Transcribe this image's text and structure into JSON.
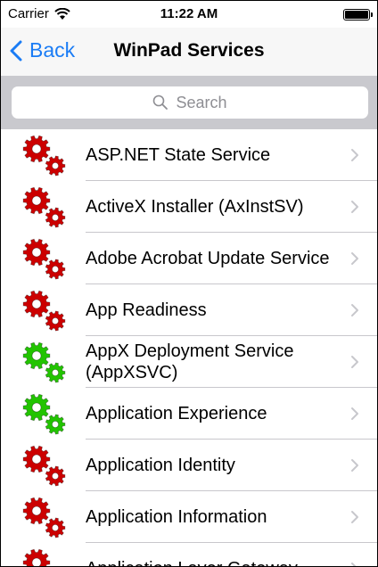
{
  "status_bar": {
    "carrier": "Carrier",
    "time": "11:22 AM"
  },
  "nav": {
    "back_label": "Back",
    "title": "WinPad Services"
  },
  "search": {
    "placeholder": "Search"
  },
  "colors": {
    "stopped": "#cc0000",
    "running": "#22c400",
    "accent": "#1a7cf5"
  },
  "services": [
    {
      "name": "ASP.NET State Service",
      "status": "stopped"
    },
    {
      "name": "ActiveX Installer (AxInstSV)",
      "status": "stopped"
    },
    {
      "name": "Adobe Acrobat Update Service",
      "status": "stopped"
    },
    {
      "name": "App Readiness",
      "status": "stopped"
    },
    {
      "name": "AppX Deployment Service (AppXSVC)",
      "status": "running"
    },
    {
      "name": "Application Experience",
      "status": "running"
    },
    {
      "name": "Application Identity",
      "status": "stopped"
    },
    {
      "name": "Application Information",
      "status": "stopped"
    },
    {
      "name": "Application Layer Gateway",
      "status": "stopped"
    }
  ]
}
